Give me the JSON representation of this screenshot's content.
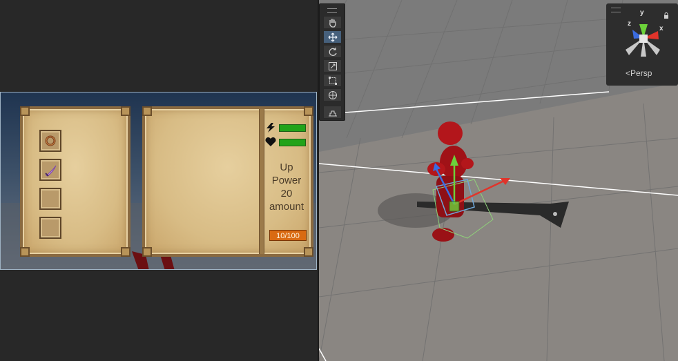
{
  "inventory": {
    "slots": [
      {
        "item": "ring-icon"
      },
      {
        "item": "curved-sword-icon"
      },
      {
        "item": "empty"
      },
      {
        "item": "empty"
      }
    ]
  },
  "details": {
    "stats": [
      {
        "icon": "lightning-icon",
        "fill": 1.0
      },
      {
        "icon": "heart-icon",
        "fill": 1.0
      }
    ],
    "description_lines": [
      "Up",
      "Power",
      "20",
      "amount"
    ],
    "progress_text": "10/100"
  },
  "scene": {
    "tools": [
      {
        "name": "hand-tool",
        "icon": "hand-icon",
        "active": false
      },
      {
        "name": "move-tool",
        "icon": "move-arrows-icon",
        "active": true
      },
      {
        "name": "rotate-tool",
        "icon": "rotate-icon",
        "active": false
      },
      {
        "name": "scale-tool",
        "icon": "scale-icon",
        "active": false
      },
      {
        "name": "rect-tool",
        "icon": "rect-icon",
        "active": false
      },
      {
        "name": "transform-tool",
        "icon": "transform-icon",
        "active": false
      },
      {
        "name": "custom-tool",
        "icon": "custom-tool-icon",
        "active": false
      }
    ],
    "gizmo": {
      "axis_x": "x",
      "axis_y": "y",
      "axis_z": "z",
      "projection_label": "Persp"
    }
  },
  "colors": {
    "stat_fill": "#22a31a",
    "progress_badge": "#d96a12",
    "parchment": "#d8bc85",
    "character_red": "#b3161b",
    "axis_x": "#e0342b",
    "axis_y": "#6cd23a",
    "axis_z": "#3b6ce0"
  }
}
